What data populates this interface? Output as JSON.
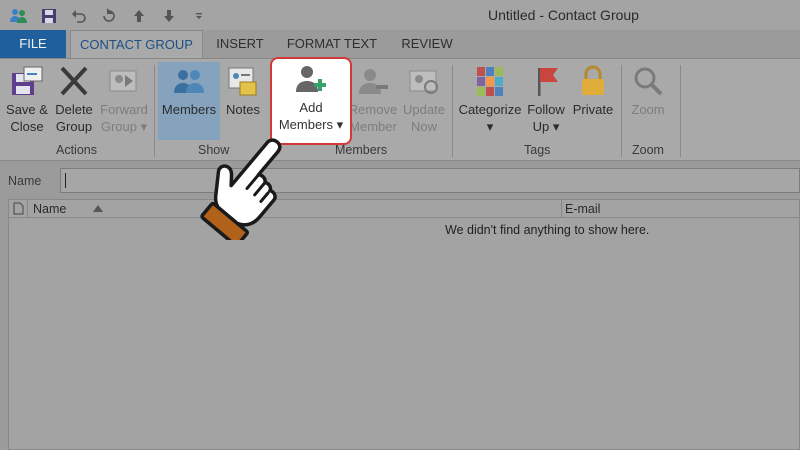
{
  "window": {
    "title": "Untitled - Contact Group"
  },
  "quick_access": [
    {
      "name": "people-icon"
    },
    {
      "name": "save-icon"
    },
    {
      "name": "undo-icon"
    },
    {
      "name": "redo-icon"
    },
    {
      "name": "up-arrow-icon"
    },
    {
      "name": "down-arrow-icon"
    },
    {
      "name": "customize-qat-icon"
    }
  ],
  "tabs": [
    {
      "label": "FILE"
    },
    {
      "label": "CONTACT GROUP"
    },
    {
      "label": "INSERT"
    },
    {
      "label": "FORMAT TEXT"
    },
    {
      "label": "REVIEW"
    }
  ],
  "ribbon": {
    "actions": {
      "group_label": "Actions",
      "save_close": {
        "line1": "Save &",
        "line2": "Close"
      },
      "delete_group": {
        "line1": "Delete",
        "line2": "Group"
      },
      "forward_group": {
        "line1": "Forward",
        "line2": "Group"
      }
    },
    "show": {
      "group_label": "Show",
      "members": "Members",
      "notes": "Notes"
    },
    "members": {
      "group_label": "Members",
      "add_members": {
        "line1": "Add",
        "line2": "Members"
      },
      "remove_member": {
        "line1": "Remove",
        "line2": "Member"
      },
      "update_now": {
        "line1": "Update",
        "line2": "Now"
      }
    },
    "tags": {
      "group_label": "Tags",
      "categorize": "Categorize",
      "follow_up": {
        "line1": "Follow",
        "line2": "Up"
      },
      "private": "Private"
    },
    "zoom": {
      "group_label": "Zoom",
      "zoom": "Zoom"
    }
  },
  "name_field": {
    "label": "Name",
    "value": ""
  },
  "list": {
    "columns": {
      "name": "Name",
      "email": "E-mail"
    },
    "empty_message": "We didn't find anything to show here."
  },
  "colors": {
    "file_tab": "#1f5f9e",
    "active_tab_text": "#1d4f85",
    "highlight_border": "#d23a3a",
    "members_selected": "#86a3bd"
  }
}
